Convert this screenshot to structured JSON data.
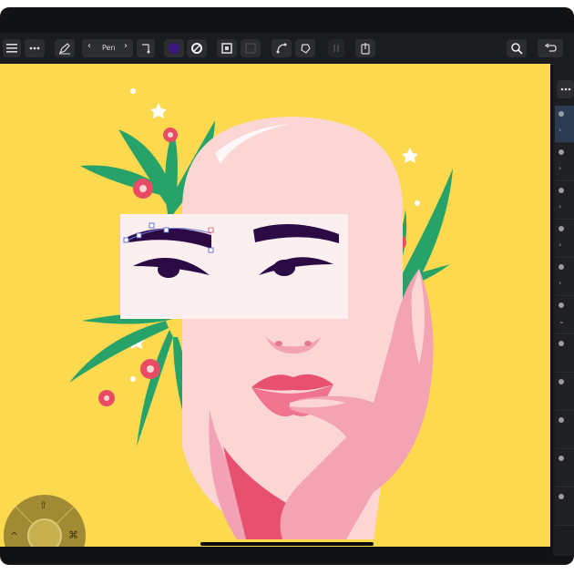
{
  "toolbar": {
    "tool_name": "Pen",
    "prev_label": "‹",
    "next_label": "›"
  },
  "icons": {
    "menu": "menu-icon",
    "more": "more-icon",
    "pen_tool": "pen-tool-icon",
    "node": "node-icon",
    "fill": "fill-color-icon",
    "stroke": "stroke-icon",
    "square": "square-icon",
    "join": "join-icon",
    "snap": "snap-icon",
    "export": "export-icon",
    "zoom": "zoom-icon",
    "undo": "undo-icon"
  },
  "colors": {
    "canvas": "#fcd94f",
    "fill_swatch": "#3a1780",
    "face": "#fbd6d4",
    "skin_pink": "#f4a3b3",
    "leaf": "#27a36a",
    "flower": "#ea4b64",
    "brow": "#2c0b45"
  },
  "gestures": {
    "up": "⇧",
    "left": "^",
    "right": "⌘",
    "down": "⌥"
  },
  "strip_chevrons": [
    "›",
    "›",
    "›",
    "›",
    "›",
    "›",
    "⌄"
  ]
}
